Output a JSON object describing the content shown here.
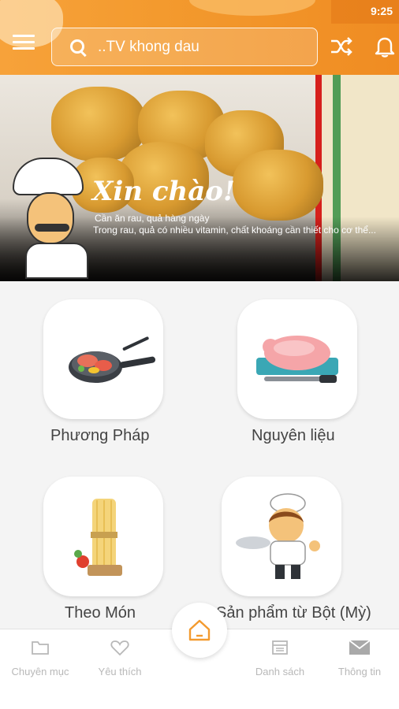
{
  "status_bar": {
    "time": "9:25"
  },
  "header": {
    "search_text": "..TV khong dau",
    "icons": {
      "menu": "menu-icon",
      "search": "search-icon",
      "shuffle": "shuffle-icon",
      "notifications": "bell-icon"
    }
  },
  "banner": {
    "greeting": "Xin chào!",
    "line1": "Cần ăn rau, quả hàng ngày",
    "line2": "Trong rau, quả có nhiều vitamin, chất khoáng cần thiết cho cơ thể..."
  },
  "categories": [
    {
      "label": "Phương Pháp",
      "icon": "frying-pan-icon"
    },
    {
      "label": "Nguyên liệu",
      "icon": "raw-meat-icon"
    },
    {
      "label": "Theo Món",
      "icon": "pasta-icon"
    },
    {
      "label": "Sản phẩm từ Bột (Mỳ)",
      "icon": "chef-icon"
    }
  ],
  "bottom_nav": {
    "items": [
      {
        "label": "Chuyên mục",
        "icon": "folder-icon"
      },
      {
        "label": "Yêu thích",
        "icon": "heart-icon"
      },
      {
        "label": "Danh sách",
        "icon": "list-icon"
      },
      {
        "label": "Thông tin",
        "icon": "mail-icon"
      }
    ],
    "home_icon": "home-icon"
  },
  "colors": {
    "accent": "#f39a2e",
    "nav_inactive": "#b8b8b8",
    "home_icon": "#f39a2e"
  }
}
